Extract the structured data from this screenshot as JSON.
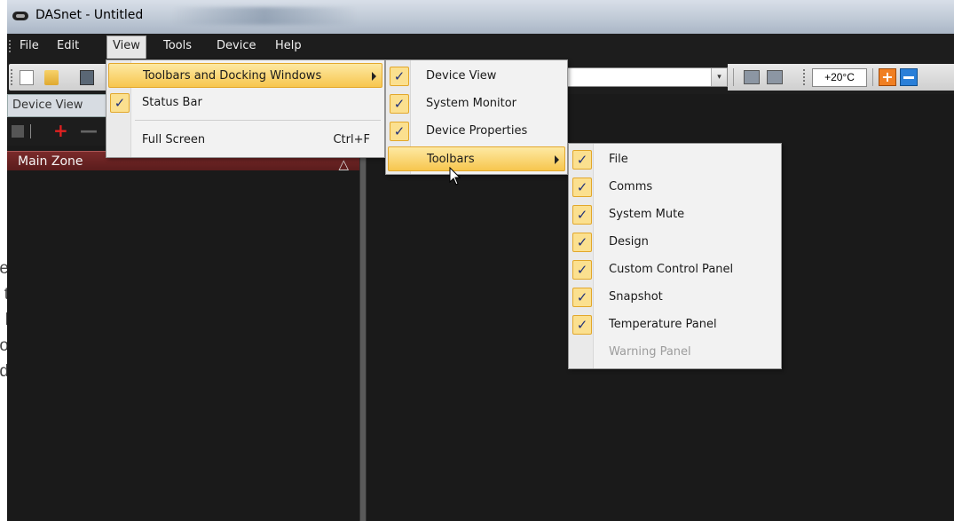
{
  "background_text": [
    "e",
    "t",
    "l",
    "o",
    "d"
  ],
  "window": {
    "title": "DASnet - Untitled"
  },
  "menubar": [
    "File",
    "Edit",
    "View",
    "Tools",
    "Device",
    "Help"
  ],
  "toolbar": {
    "temperature": "+20°C"
  },
  "device_view": {
    "header": "Device View",
    "zone": "Main Zone"
  },
  "view_menu": {
    "items": [
      {
        "label": "Toolbars and Docking Windows"
      },
      {
        "label": "Status Bar"
      },
      {
        "label": "Full Screen",
        "shortcut": "Ctrl+F"
      }
    ]
  },
  "docking_menu": {
    "items": [
      {
        "label": "Device View"
      },
      {
        "label": "System Monitor"
      },
      {
        "label": "Device Properties"
      },
      {
        "label": "Toolbars"
      }
    ]
  },
  "toolbars_menu": {
    "items": [
      {
        "label": "File"
      },
      {
        "label": "Comms"
      },
      {
        "label": "System Mute"
      },
      {
        "label": "Design"
      },
      {
        "label": "Custom Control Panel"
      },
      {
        "label": "Snapshot"
      },
      {
        "label": "Temperature Panel"
      },
      {
        "label": "Warning Panel"
      }
    ]
  },
  "glyphs": {
    "check": "✓",
    "plus": "+",
    "minus": "—",
    "warning_tri": "△",
    "combo_arrow": "▾"
  }
}
